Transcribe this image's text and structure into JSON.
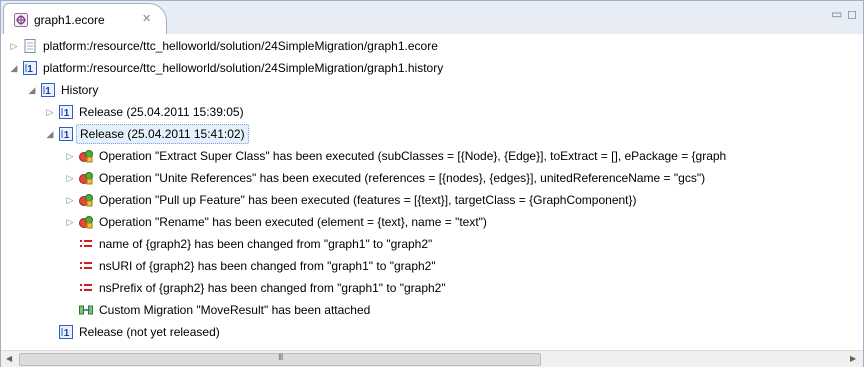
{
  "editor": {
    "tab_title": "graph1.ecore",
    "tab_icon": "ecore-file-icon",
    "close_icon": "close-icon",
    "minimize_icon": "minimize-icon",
    "maximize_icon": "maximize-icon"
  },
  "tree": {
    "rows": [
      {
        "name": "resource-ecore",
        "text": "platform:/resource/ttc_helloworld/solution/24SimpleMigration/graph1.ecore",
        "icon": "file-icon",
        "twisty": "collapsed"
      },
      {
        "name": "resource-history",
        "text": "platform:/resource/ttc_helloworld/solution/24SimpleMigration/graph1.history",
        "icon": "history-icon",
        "twisty": "expanded"
      },
      {
        "name": "history",
        "text": "History",
        "icon": "history-icon",
        "twisty": "expanded"
      },
      {
        "name": "release-1",
        "text": "Release (25.04.2011 15:39:05)",
        "icon": "release-icon",
        "twisty": "collapsed"
      },
      {
        "name": "release-2",
        "text": "Release (25.04.2011 15:41:02)",
        "icon": "release-icon",
        "twisty": "expanded",
        "selected": true
      },
      {
        "name": "operation-extract-super-class",
        "text": "Operation \"Extract Super Class\" has been executed (subClasses = [{Node}, {Edge}], toExtract = [], ePackage = {graph",
        "icon": "operation-icon",
        "twisty": "collapsed"
      },
      {
        "name": "operation-unite-references",
        "text": "Operation \"Unite References\" has been executed (references = [{nodes}, {edges}], unitedReferenceName = \"gcs\")",
        "icon": "operation-icon",
        "twisty": "collapsed"
      },
      {
        "name": "operation-pull-up-feature",
        "text": "Operation \"Pull up Feature\" has been executed (features = [{text}], targetClass = {GraphComponent})",
        "icon": "operation-icon",
        "twisty": "collapsed"
      },
      {
        "name": "operation-rename",
        "text": "Operation \"Rename\" has been executed (element = {text}, name = \"text\")",
        "icon": "operation-icon",
        "twisty": "collapsed"
      },
      {
        "name": "change-name",
        "text": "name of {graph2} has been changed from \"graph1\" to \"graph2\"",
        "icon": "set-icon",
        "twisty": "none"
      },
      {
        "name": "change-nsuri",
        "text": "nsURI of {graph2} has been changed from \"graph1\" to \"graph2\"",
        "icon": "set-icon",
        "twisty": "none"
      },
      {
        "name": "change-nsprefix",
        "text": "nsPrefix of {graph2} has been changed from \"graph1\" to \"graph2\"",
        "icon": "set-icon",
        "twisty": "none"
      },
      {
        "name": "custom-migration",
        "text": "Custom Migration \"MoveResult\" has been attached",
        "icon": "migration-icon",
        "twisty": "none"
      },
      {
        "name": "release-unreleased",
        "text": "Release (not yet released)",
        "icon": "release-icon",
        "twisty": "none"
      }
    ]
  },
  "scrollbar": {
    "left_icon": "scroll-left-icon",
    "right_icon": "scroll-right-icon",
    "grip_text": "III"
  }
}
